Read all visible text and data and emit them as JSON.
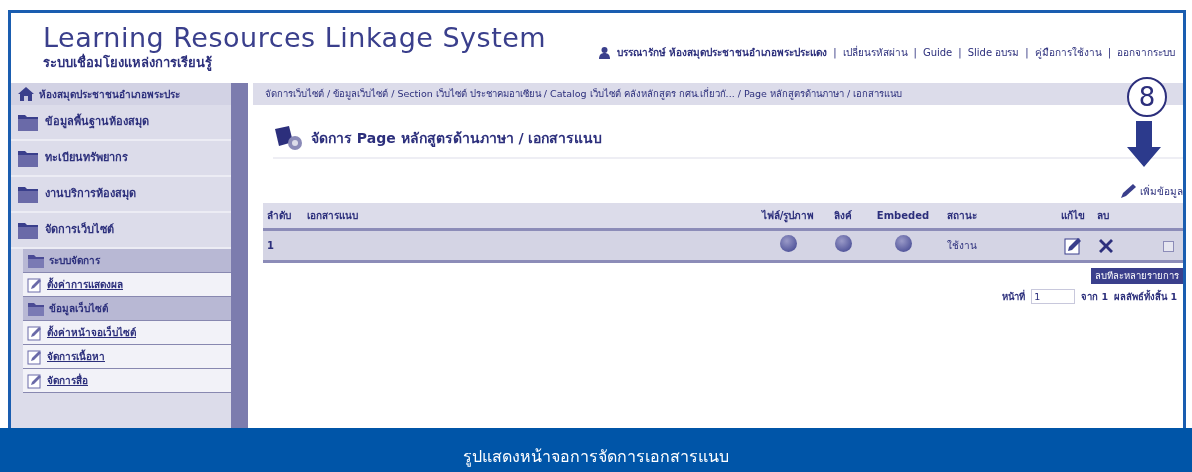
{
  "header": {
    "title": "Learning Resources Linkage System",
    "subtitle": "ระบบเชื่อมโยงแหล่งการเรียนรู้",
    "user": "บรรณารักษ์ ห้องสมุดประชาชนอำเภอพระประแดง",
    "separator": "|",
    "links": [
      "เปลี่ยนรหัสผ่าน",
      "Guide",
      "Slide อบรม",
      "คู่มือการใช้งาน",
      "ออกจากระบบ"
    ]
  },
  "sidebar": {
    "home": "ห้องสมุดประชาชนอำเภอพระประ",
    "items": [
      {
        "label": "ข้อมูลพื้นฐานห้องสมุด"
      },
      {
        "label": "ทะเบียนทรัพยากร"
      },
      {
        "label": "งานบริการห้องสมุด"
      },
      {
        "label": "จัดการเว็บไซต์",
        "children": [
          {
            "label": "ระบบจัดการ",
            "children": [
              {
                "label": "ตั้งค่าการแสดงผล"
              }
            ]
          },
          {
            "label": "ข้อมูลเว็บไซต์",
            "children": [
              {
                "label": "ตั้งค่าหน้าจอเว็บไซต์"
              },
              {
                "label": "จัดการเนื้อหา"
              },
              {
                "label": "จัดการสื่อ"
              }
            ]
          }
        ]
      }
    ]
  },
  "breadcrumb": "จัดการเว็บไซต์ / ข้อมูลเว็บไซต์ / Section เว็บไซต์ ประชาคมอาเซียน / Catalog เว็บไซต์ คลังหลักสูตร กศน.เกี่ยวกั... / Page หลักสูตรด้านภาษา / เอกสารแนบ",
  "annotation": "8",
  "page_title": "จัดการ Page หลักสูตรด้านภาษา / เอกสารแนบ",
  "add_button": "เพิ่มข้อมูล",
  "table": {
    "columns": [
      "ลำดับ",
      "เอกสารแนบ",
      "ไฟล์/รูปภาพ",
      "ลิงค์",
      "Embeded",
      "สถานะ",
      "แก้ไข",
      "ลบ"
    ],
    "rows": [
      {
        "number": "1",
        "status": "ใช้งาน",
        "checked": false
      }
    ]
  },
  "delete_many_button": "ลบทีละหลายรายการ",
  "pagination": {
    "page_label": "หน้าที่",
    "page_value": "1",
    "of": "จาก 1",
    "total": "ผลลัพธ์ทั้งสิ้น 1"
  },
  "caption": "รูปแสดงหน้าจอการจัดการเอกสารแนบ"
}
